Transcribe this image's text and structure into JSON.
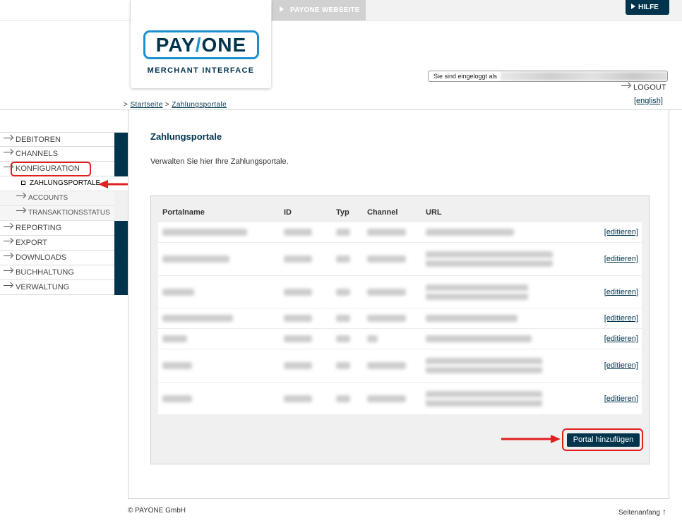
{
  "header": {
    "website_tab": "PAYONE WEBSEITE",
    "help_button": "HILFE",
    "logo_main_left": "PAY",
    "logo_slash": "/",
    "logo_main_right": "ONE",
    "logo_sub": "MERCHANT INTERFACE",
    "logged_in_label": "Sie sind eingeloggt als",
    "logout": "LOGOUT",
    "language_link": "[english]"
  },
  "breadcrumb": {
    "separator": ">",
    "items": [
      "Startseite",
      "Zahlungsportale"
    ]
  },
  "sidebar": {
    "items": [
      {
        "label": "DEBITOREN"
      },
      {
        "label": "CHANNELS"
      },
      {
        "label": "KONFIGURATION"
      },
      {
        "label": "REPORTING"
      },
      {
        "label": "EXPORT"
      },
      {
        "label": "DOWNLOADS"
      },
      {
        "label": "BUCHHALTUNG"
      },
      {
        "label": "VERWALTUNG"
      }
    ],
    "subitems": [
      {
        "label": "ZAHLUNGSPORTALE",
        "active": true
      },
      {
        "label": "ACCOUNTS"
      },
      {
        "label": "TRANSAKTIONSSTATUS"
      }
    ]
  },
  "main": {
    "title": "Zahlungsportale",
    "intro": "Verwalten Sie hier Ihre Zahlungsportale.",
    "columns": [
      "Portalname",
      "ID",
      "Typ",
      "Channel",
      "URL"
    ],
    "edit_label": "[edi​tieren]",
    "edit_text": "[editieren]",
    "add_button": "Portal hinzufügen"
  },
  "footer": {
    "copyright": "© PAYONE GmbH",
    "top_link": "Seitenanfang",
    "top_arrow": "↑"
  },
  "colors": {
    "brand_dark": "#00344d",
    "brand_light": "#1d8fd0",
    "highlight": "#e02020"
  }
}
